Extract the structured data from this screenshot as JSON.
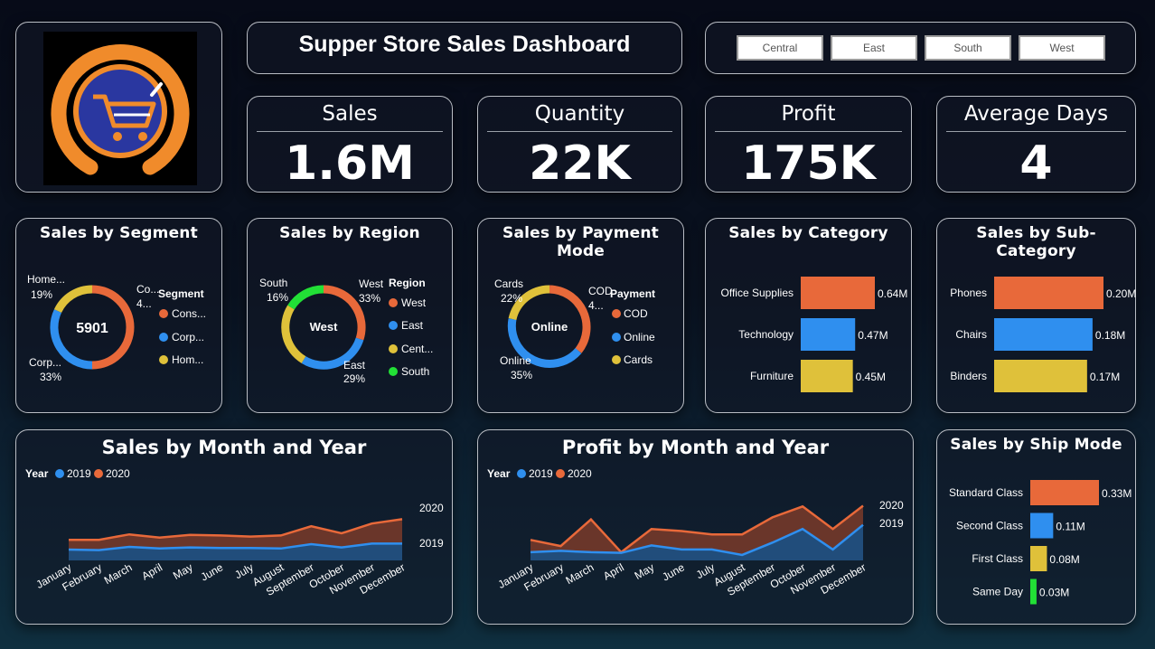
{
  "header": {
    "title": "Supper Store Sales Dashboard"
  },
  "region_slicer": {
    "options": [
      "Central",
      "East",
      "South",
      "West"
    ]
  },
  "kpis": [
    {
      "label": "Sales",
      "value": "1.6M"
    },
    {
      "label": "Quantity",
      "value": "22K"
    },
    {
      "label": "Profit",
      "value": "175K"
    },
    {
      "label": "Average Days",
      "value": "4"
    }
  ],
  "colors": {
    "orange": "#e8693a",
    "blue": "#2f8fef",
    "yellow": "#dfc13a",
    "green": "#22e036",
    "card_border": "#b9bdc4"
  },
  "logo": {
    "icon": "shopping-cart-icon"
  },
  "segment": {
    "title": "Sales by Segment",
    "center": "5901",
    "legend_title": "Segment",
    "legend": [
      "Cons...",
      "Corp...",
      "Hom..."
    ],
    "labels": [
      {
        "name": "Co...",
        "pct": "4..."
      },
      {
        "name": "Corp...",
        "pct": "33%"
      },
      {
        "name": "Home...",
        "pct": "19%"
      }
    ]
  },
  "region": {
    "title": "Sales by Region",
    "center": "West",
    "legend_title": "Region",
    "legend": [
      "West",
      "East",
      "Cent...",
      "South"
    ],
    "labels": [
      {
        "name": "West",
        "pct": "33%"
      },
      {
        "name": "East",
        "pct": "29%"
      },
      {
        "name": "South",
        "pct": "16%"
      }
    ]
  },
  "payment": {
    "title": "Sales by Payment Mode",
    "center": "Online",
    "legend_title": "Payment",
    "legend": [
      "COD",
      "Online",
      "Cards"
    ],
    "labels": [
      {
        "name": "COD",
        "pct": "4..."
      },
      {
        "name": "Online",
        "pct": "35%"
      },
      {
        "name": "Cards",
        "pct": "22%"
      }
    ]
  },
  "category": {
    "title": "Sales by Category",
    "bars": [
      {
        "label": "Office Supplies",
        "value": 0.64,
        "text": "0.64M",
        "color": "#e8693a"
      },
      {
        "label": "Technology",
        "value": 0.47,
        "text": "0.47M",
        "color": "#2f8fef"
      },
      {
        "label": "Furniture",
        "value": 0.45,
        "text": "0.45M",
        "color": "#dfc13a"
      }
    ]
  },
  "subcategory": {
    "title": "Sales by Sub-Category",
    "bars": [
      {
        "label": "Phones",
        "value": 0.2,
        "text": "0.20M",
        "color": "#e8693a"
      },
      {
        "label": "Chairs",
        "value": 0.18,
        "text": "0.18M",
        "color": "#2f8fef"
      },
      {
        "label": "Binders",
        "value": 0.17,
        "text": "0.17M",
        "color": "#dfc13a"
      }
    ]
  },
  "shipmode": {
    "title": "Sales by Ship Mode",
    "bars": [
      {
        "label": "Standard Class",
        "value": 0.33,
        "text": "0.33M",
        "color": "#e8693a"
      },
      {
        "label": "Second Class",
        "value": 0.11,
        "text": "0.11M",
        "color": "#2f8fef"
      },
      {
        "label": "First Class",
        "value": 0.08,
        "text": "0.08M",
        "color": "#dfc13a"
      },
      {
        "label": "Same Day",
        "value": 0.03,
        "text": "0.03M",
        "color": "#22e036"
      }
    ]
  },
  "sales_month": {
    "title": "Sales by Month and Year",
    "legend_title": "Year",
    "series_labels": [
      "2019",
      "2020"
    ],
    "end_labels": [
      "2020",
      "2019"
    ]
  },
  "profit_month": {
    "title": "Profit by Month and Year",
    "legend_title": "Year",
    "series_labels": [
      "2019",
      "2020"
    ],
    "end_labels": [
      "2020",
      "2019"
    ]
  },
  "chart_data": [
    {
      "type": "area",
      "title": "Sales by Month and Year",
      "categories": [
        "January",
        "February",
        "March",
        "April",
        "May",
        "June",
        "July",
        "August",
        "September",
        "October",
        "November",
        "December"
      ],
      "series": [
        {
          "name": "2019",
          "values": [
            20,
            19,
            25,
            22,
            24,
            23,
            23,
            22,
            30,
            24,
            31,
            31
          ]
        },
        {
          "name": "2020",
          "values": [
            38,
            38,
            48,
            42,
            47,
            46,
            44,
            46,
            63,
            50,
            68,
            76
          ]
        }
      ]
    },
    {
      "type": "area",
      "title": "Profit by Month and Year",
      "categories": [
        "January",
        "February",
        "March",
        "April",
        "May",
        "June",
        "July",
        "August",
        "September",
        "October",
        "November",
        "December"
      ],
      "series": [
        {
          "name": "2019",
          "values": [
            12,
            14,
            12,
            11,
            22,
            16,
            16,
            8,
            26,
            46,
            16,
            52
          ]
        },
        {
          "name": "2020",
          "values": [
            30,
            21,
            60,
            12,
            46,
            43,
            38,
            38,
            63,
            79,
            46,
            80
          ]
        }
      ]
    }
  ]
}
